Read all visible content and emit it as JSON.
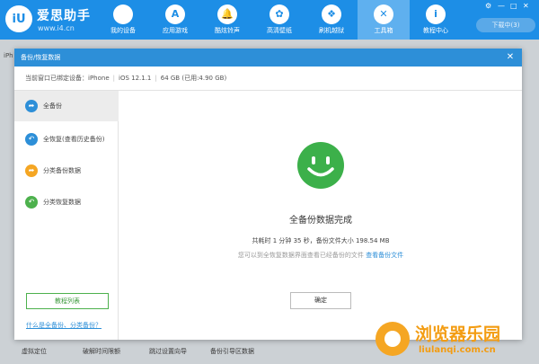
{
  "app": {
    "brand": "爱思助手",
    "url": "www.i4.cn",
    "logo_text": "iU",
    "nav": [
      {
        "label": "我的设备",
        "icon": "apple-icon",
        "glyph": ""
      },
      {
        "label": "应用游戏",
        "icon": "app-store-icon",
        "glyph": "A"
      },
      {
        "label": "酷炫铃声",
        "icon": "bell-icon",
        "glyph": "🔔"
      },
      {
        "label": "高清壁纸",
        "icon": "flower-icon",
        "glyph": "✿"
      },
      {
        "label": "刷机越狱",
        "icon": "dropbox-icon",
        "glyph": "❖"
      },
      {
        "label": "工具箱",
        "icon": "tools-icon",
        "glyph": "✕"
      },
      {
        "label": "教程中心",
        "icon": "info-icon",
        "glyph": "i"
      }
    ],
    "download_label": "下载中(3)",
    "window_controls": [
      "⚙",
      "—",
      "□",
      "✕"
    ],
    "bg_tab": "iPh",
    "bottom_items": [
      "虚拟定位",
      "破解时间限额",
      "跳过设置向导",
      "备份引导区数据"
    ]
  },
  "modal": {
    "title": "备份/恢复数据",
    "close_glyph": "✕",
    "device_label": "当前窗口已绑定设备：iPhone",
    "ios_version": "iOS 12.1.1",
    "storage": "64 GB (已用:4.90 GB)",
    "sidebar": [
      {
        "label": "全备份",
        "icon": "backup-arrow-icon",
        "glyph": "➦",
        "color": "#2d8fd8"
      },
      {
        "label": "全恢复(查看历史备份)",
        "icon": "restore-arrow-icon",
        "glyph": "↶",
        "color": "#2d8fd8"
      },
      {
        "label": "分类备份数据",
        "icon": "category-backup-icon",
        "glyph": "➦",
        "color": "#f5a623"
      },
      {
        "label": "分类恢复数据",
        "icon": "category-restore-icon",
        "glyph": "↶",
        "color": "#4db14d"
      }
    ],
    "tutorial_label": "教程列表",
    "help_link": "什么是全备份、分类备份？",
    "done_title": "全备份数据完成",
    "stats_text": "共耗时 1 分钟 35 秒，备份文件大小 198.54 MB",
    "note_text": "您可以到全恢复数据界面查看已经备份的文件",
    "note_link": "查看备份文件",
    "ok_label": "确定",
    "success_color": "#3cb04a"
  },
  "watermark": {
    "text": "浏览器乐园",
    "url": "liulanqi.com.cn"
  }
}
